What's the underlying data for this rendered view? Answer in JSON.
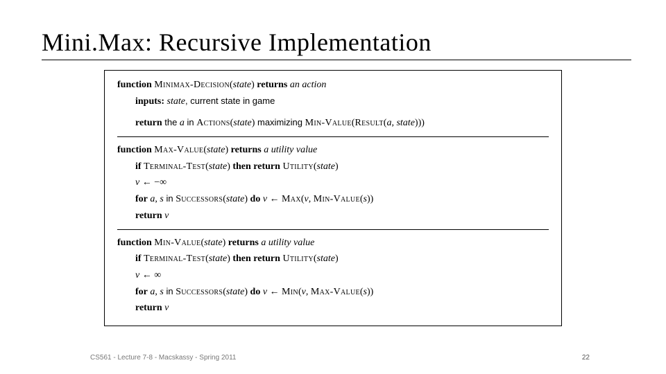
{
  "title": "Mini.Max: Recursive Implementation",
  "footer": {
    "left": "CS561 - Lecture 7-8 - Macskassy - Spring 2011",
    "page": "22"
  },
  "fn1": {
    "kw_function": "function",
    "name": "Minimax-Decision",
    "argopen": "(",
    "arg": "state",
    "argclose": ")",
    "kw_returns": "returns",
    "ret": "an action",
    "kw_inputs": "inputs:",
    "inp_arg": "state",
    "inp_desc": ", current state in game",
    "kw_return": "return",
    "ret_pre": " the ",
    "ret_a": "a",
    "ret_in": " in ",
    "actions": "Actions",
    "ret_ao": "(",
    "ret_arg": "state",
    "ret_ac": ")",
    "ret_mid": " maximizing ",
    "minval": "Min-Value",
    "ret_ro": "(",
    "result": "Result",
    "ret_rio": "(",
    "ret_ra": "a",
    "ret_comma": ", ",
    "ret_rs": "state",
    "ret_ric": ")",
    "ret_rc": ")",
    "ret_rc2": ")"
  },
  "fn2": {
    "kw_function": "function",
    "name": "Max-Value",
    "argopen": "(",
    "arg": "state",
    "argclose": ")",
    "kw_returns": "returns",
    "ret": "a utility value",
    "kw_if": "if",
    "term": "Terminal-Test",
    "to": "(",
    "targ": "state",
    "tc": ")",
    "kw_then": "then return",
    "util": "Utility",
    "uo": "(",
    "uarg": "state",
    "uc": ")",
    "init_v": "v",
    "init_rest": " ← −∞",
    "kw_for": "for",
    "for_a": "a",
    "fc1": ", ",
    "for_s": "s",
    "f_in": " in ",
    "succ": "Successors",
    "so": "(",
    "sarg": "state",
    "sc": ")",
    "kw_do": "do",
    "upd_v": " v",
    "upd_arrow": " ← ",
    "max": "Max",
    "mo": "(",
    "mv": "v",
    "mcom": ", ",
    "minval": "Min-Value",
    "mvo": "(",
    "mvs": "s",
    "mvc": ")",
    "mc": ")",
    "kw_return": "return",
    "ret_v": "v"
  },
  "fn3": {
    "kw_function": "function",
    "name": "Min-Value",
    "argopen": "(",
    "arg": "state",
    "argclose": ")",
    "kw_returns": "returns",
    "ret": "a utility value",
    "kw_if": "if",
    "term": "Terminal-Test",
    "to": "(",
    "targ": "state",
    "tc": ")",
    "kw_then": "then return",
    "util": "Utility",
    "uo": "(",
    "uarg": "state",
    "uc": ")",
    "init_v": "v",
    "init_rest": " ← ∞",
    "kw_for": "for",
    "for_a": "a",
    "fc1": ", ",
    "for_s": "s",
    "f_in": " in ",
    "succ": "Successors",
    "so": "(",
    "sarg": "state",
    "sc": ")",
    "kw_do": "do",
    "upd_v": " v",
    "upd_arrow": " ← ",
    "min": "Min",
    "mo": "(",
    "mv": "v",
    "mcom": ", ",
    "maxval": "Max-Value",
    "mvo": "(",
    "mvs": "s",
    "mvc": ")",
    "mc": ")",
    "kw_return": "return",
    "ret_v": "v"
  }
}
